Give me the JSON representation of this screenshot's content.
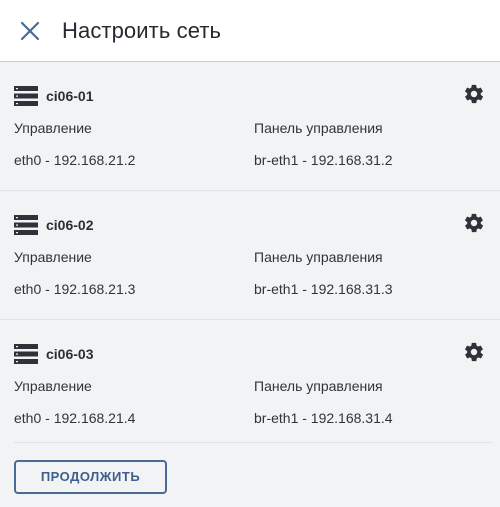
{
  "header": {
    "title": "Настроить сеть",
    "close_icon": "close-icon"
  },
  "nodes": [
    {
      "name": "ci06-01",
      "mgmt_label": "Управление",
      "mgmt_value": "eth0 - 192.168.21.2",
      "panel_label": "Панель управления",
      "panel_value": "br-eth1 - 192.168.31.2"
    },
    {
      "name": "ci06-02",
      "mgmt_label": "Управление",
      "mgmt_value": "eth0 - 192.168.21.3",
      "panel_label": "Панель управления",
      "panel_value": "br-eth1 - 192.168.31.3"
    },
    {
      "name": "ci06-03",
      "mgmt_label": "Управление",
      "mgmt_value": "eth0 - 192.168.21.4",
      "panel_label": "Панель управления",
      "panel_value": "br-eth1 - 192.168.31.4"
    }
  ],
  "footer": {
    "continue_label": "ПРОДОЛЖИТЬ"
  },
  "colors": {
    "accent": "#4a6b94",
    "background": "#f2f3f5",
    "header_bg": "#ffffff"
  }
}
